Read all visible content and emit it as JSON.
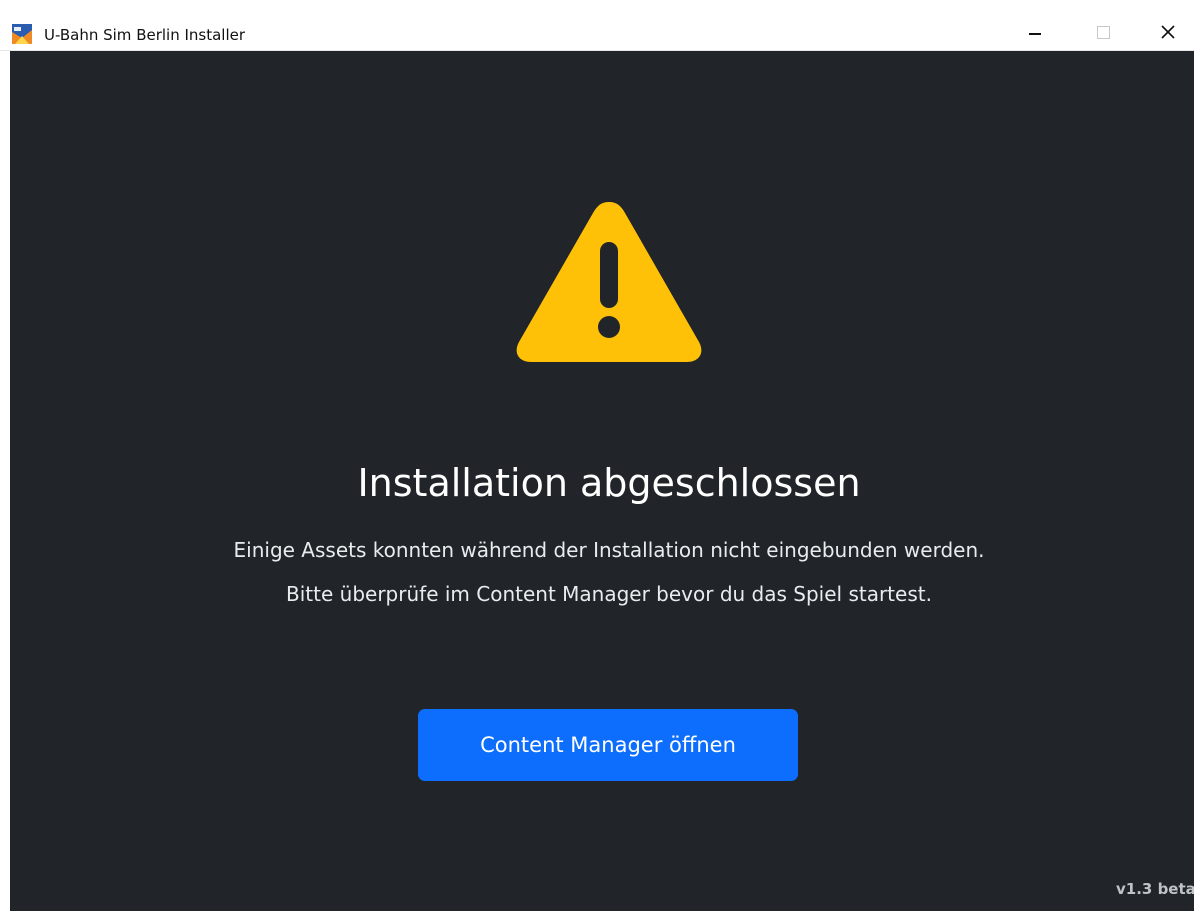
{
  "window": {
    "title": "U-Bahn Sim Berlin Installer",
    "controls": {
      "minimize": "minimize",
      "maximize": "maximize",
      "close": "✕"
    }
  },
  "main": {
    "icon": "warning-triangle-icon",
    "heading": "Installation abgeschlossen",
    "message_line_1": "Einige Assets konnten während der Installation nicht eingebunden werden.",
    "message_line_2": "Bitte überprüfe im Content Manager bevor du das Spiel startest.",
    "button_label": "Content Manager öffnen",
    "version": "v1.3 beta"
  },
  "colors": {
    "background": "#212529",
    "warning": "#ffc107",
    "primary": "#0d6efd"
  }
}
